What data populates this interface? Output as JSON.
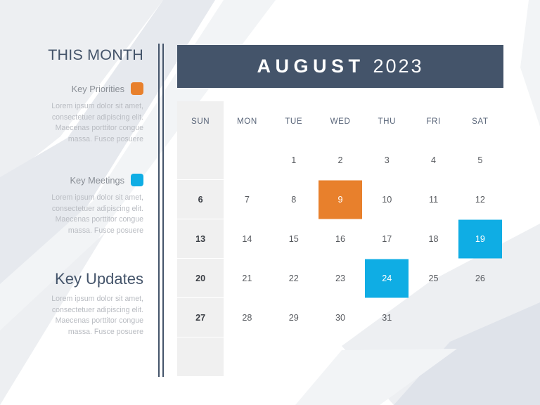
{
  "sidebar": {
    "this_month_title": "THIS MONTH",
    "key_updates_title": "Key Updates",
    "legend": [
      {
        "label": "Key Priorities",
        "swatch_name": "orange-swatch",
        "color": "#E8802C",
        "body": "Lorem ipsum dolor sit amet, consectetuer adipiscing elit. Maecenas porttitor congue massa. Fusce posuere"
      },
      {
        "label": "Key Meetings",
        "swatch_name": "blue-swatch",
        "color": "#0FADE4",
        "body": "Lorem ipsum dolor sit amet, consectetuer adipiscing elit. Maecenas porttitor congue massa. Fusce posuere"
      }
    ],
    "key_updates_body": "Lorem ipsum dolor sit amet, consectetuer adipiscing elit. Maecenas porttitor congue massa. Fusce posuere"
  },
  "calendar": {
    "month": "AUGUST",
    "year": "2023",
    "header_color": "#44546A",
    "weekday_headers": [
      "SUN",
      "MON",
      "TUE",
      "WED",
      "THU",
      "FRI",
      "SAT"
    ],
    "sunday_column_color": "#F0F0F0",
    "highlight_colors": {
      "priority": "#E8802C",
      "meeting": "#0FADE4"
    },
    "weeks": [
      [
        {
          "day": ""
        },
        {
          "day": ""
        },
        {
          "day": "1"
        },
        {
          "day": "2"
        },
        {
          "day": "3"
        },
        {
          "day": "4"
        },
        {
          "day": "5"
        }
      ],
      [
        {
          "day": "6"
        },
        {
          "day": "7"
        },
        {
          "day": "8"
        },
        {
          "day": "9",
          "highlight": "priority"
        },
        {
          "day": "10"
        },
        {
          "day": "11"
        },
        {
          "day": "12"
        }
      ],
      [
        {
          "day": "13"
        },
        {
          "day": "14"
        },
        {
          "day": "15"
        },
        {
          "day": "16"
        },
        {
          "day": "17"
        },
        {
          "day": "18"
        },
        {
          "day": "19",
          "highlight": "meeting"
        }
      ],
      [
        {
          "day": "20"
        },
        {
          "day": "21"
        },
        {
          "day": "22"
        },
        {
          "day": "23"
        },
        {
          "day": "24",
          "highlight": "meeting"
        },
        {
          "day": "25"
        },
        {
          "day": "26"
        }
      ],
      [
        {
          "day": "27"
        },
        {
          "day": "28"
        },
        {
          "day": "29"
        },
        {
          "day": "30"
        },
        {
          "day": "31"
        },
        {
          "day": ""
        },
        {
          "day": ""
        }
      ],
      [
        {
          "day": ""
        },
        {
          "day": ""
        },
        {
          "day": ""
        },
        {
          "day": ""
        },
        {
          "day": ""
        },
        {
          "day": ""
        },
        {
          "day": ""
        }
      ]
    ]
  },
  "background": {
    "shade_1": "#EDEFF2",
    "shade_2": "#E6E9EE",
    "shade_3": "#F2F4F6",
    "shade_4": "#DFE3EA"
  }
}
